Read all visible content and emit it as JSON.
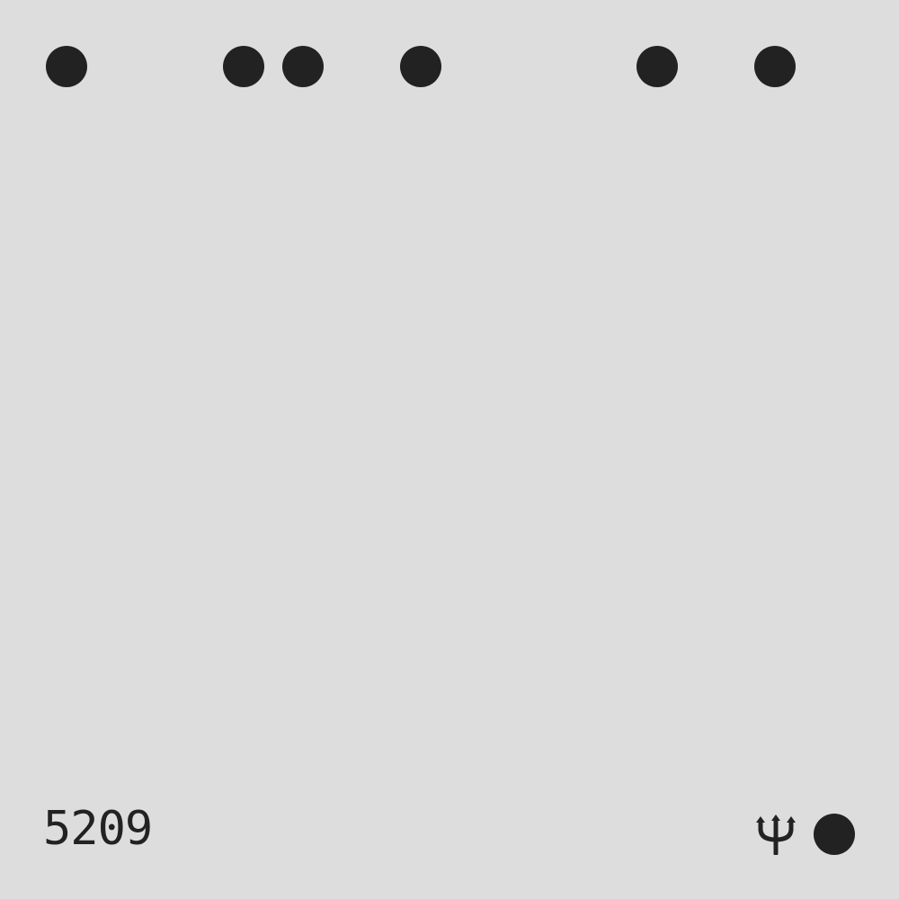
{
  "colors": {
    "background": "#dddddd",
    "foreground": "#222222"
  },
  "top_row": {
    "dot_count": 6
  },
  "footer": {
    "number": "5209",
    "symbol_icon": "trident-icon",
    "marker_icon": "filled-circle-icon"
  }
}
